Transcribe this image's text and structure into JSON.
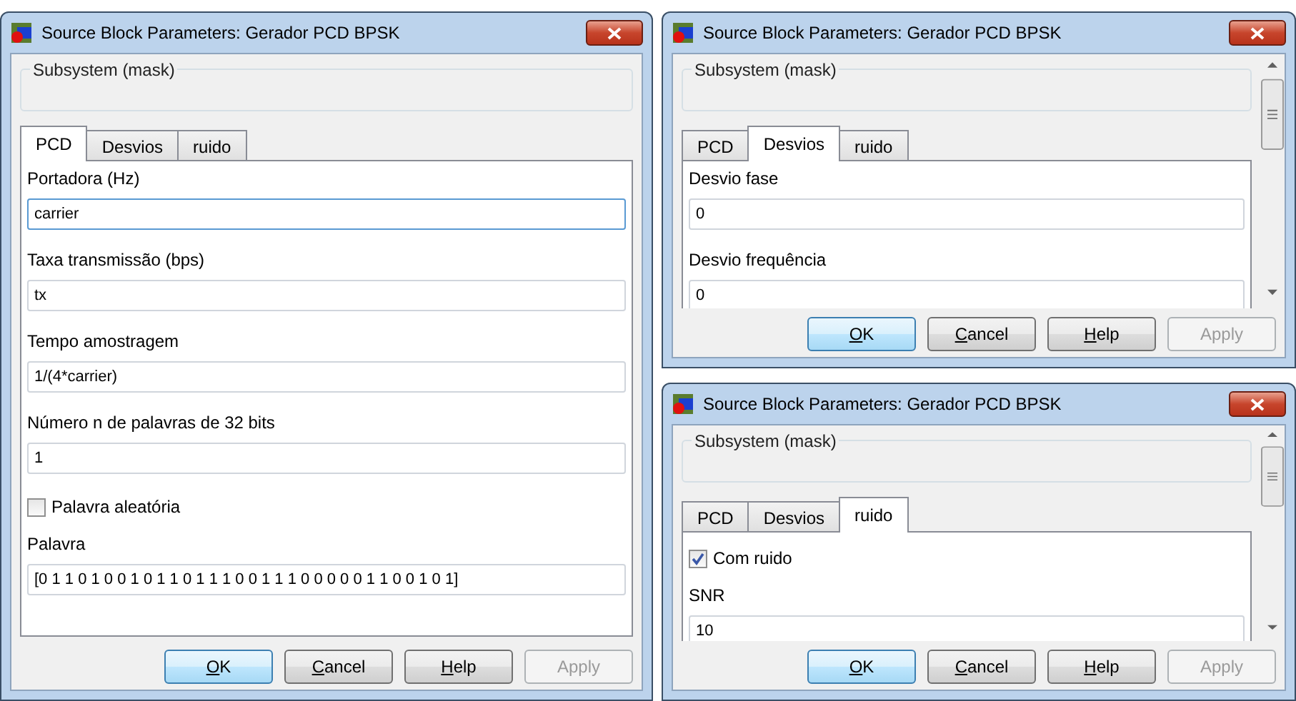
{
  "dialogs": [
    {
      "title": "Source Block Parameters: Gerador PCD BPSK",
      "group_label": "Subsystem (mask)",
      "scrollbar": false,
      "tabs": [
        {
          "label": "PCD",
          "selected": true
        },
        {
          "label": "Desvios",
          "selected": false
        },
        {
          "label": "ruido",
          "selected": false
        }
      ],
      "fields": [
        {
          "kind": "text",
          "label": "Portadora (Hz)",
          "value": "carrier",
          "focused": true
        },
        {
          "kind": "text",
          "label": "Taxa transmissão (bps)",
          "value": "tx",
          "focused": false
        },
        {
          "kind": "text",
          "label": "Tempo amostragem",
          "value": "1/(4*carrier)",
          "focused": false
        },
        {
          "kind": "text",
          "label": "Número n de palavras de 32 bits",
          "value": "1",
          "focused": false
        },
        {
          "kind": "checkbox",
          "label": "Palavra aleatória",
          "checked": false
        },
        {
          "kind": "text",
          "label": "Palavra",
          "value": "[0 1 1 0 1 0 0 1 0 1 1 0 1 1 1 0 0 1 1 1 0 0 0 0 0 1 1 0 0 1 0 1]",
          "focused": false
        }
      ],
      "buttons": [
        {
          "label": "OK",
          "focused": true,
          "mnemonic": true,
          "disabled": false
        },
        {
          "label": "Cancel",
          "focused": false,
          "mnemonic": true,
          "disabled": false
        },
        {
          "label": "Help",
          "focused": false,
          "mnemonic": true,
          "disabled": false
        },
        {
          "label": "Apply",
          "focused": false,
          "mnemonic": false,
          "disabled": true
        }
      ]
    },
    {
      "title": "Source Block Parameters: Gerador PCD BPSK",
      "group_label": "Subsystem (mask)",
      "scrollbar": true,
      "tabs": [
        {
          "label": "PCD",
          "selected": false
        },
        {
          "label": "Desvios",
          "selected": true
        },
        {
          "label": "ruido",
          "selected": false
        }
      ],
      "fields": [
        {
          "kind": "text",
          "label": "Desvio fase",
          "value": "0",
          "focused": false
        },
        {
          "kind": "text",
          "label": "Desvio frequência",
          "value": "0",
          "focused": false
        }
      ],
      "buttons": [
        {
          "label": "OK",
          "focused": true,
          "mnemonic": true,
          "disabled": false
        },
        {
          "label": "Cancel",
          "focused": false,
          "mnemonic": true,
          "disabled": false
        },
        {
          "label": "Help",
          "focused": false,
          "mnemonic": true,
          "disabled": false
        },
        {
          "label": "Apply",
          "focused": false,
          "mnemonic": false,
          "disabled": true
        }
      ]
    },
    {
      "title": "Source Block Parameters: Gerador PCD BPSK",
      "group_label": "Subsystem (mask)",
      "scrollbar": true,
      "tabs": [
        {
          "label": "PCD",
          "selected": false
        },
        {
          "label": "Desvios",
          "selected": false
        },
        {
          "label": "ruido",
          "selected": true
        }
      ],
      "fields": [
        {
          "kind": "checkbox",
          "label": "Com ruido",
          "checked": true
        },
        {
          "kind": "text",
          "label": "SNR",
          "value": "10",
          "focused": false
        }
      ],
      "buttons": [
        {
          "label": "OK",
          "focused": true,
          "mnemonic": true,
          "disabled": false
        },
        {
          "label": "Cancel",
          "focused": false,
          "mnemonic": true,
          "disabled": false
        },
        {
          "label": "Help",
          "focused": false,
          "mnemonic": true,
          "disabled": false
        },
        {
          "label": "Apply",
          "focused": false,
          "mnemonic": false,
          "disabled": true
        }
      ]
    }
  ]
}
